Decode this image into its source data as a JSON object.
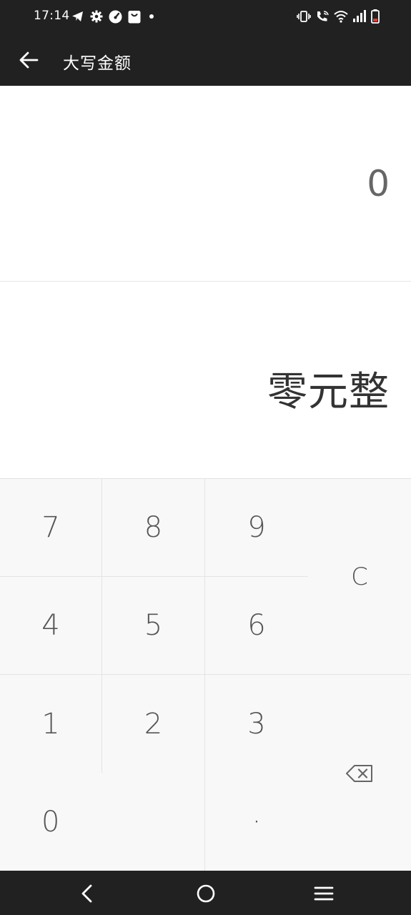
{
  "status_bar": {
    "time": "17:14",
    "left_icons": [
      "telegram-icon",
      "gear-icon",
      "speedometer-icon",
      "shopping-bag-icon",
      "dot-icon"
    ],
    "right_icons": [
      "vibrate-icon",
      "wifi-calling-icon",
      "wifi-icon",
      "signal-icon",
      "battery-icon"
    ],
    "battery_color": "#e53935"
  },
  "app_bar": {
    "title": "大写金额",
    "back_icon": "arrow-left-icon",
    "background": "#212121"
  },
  "display": {
    "number": "0",
    "chinese": "零元整"
  },
  "keypad": {
    "k7": "7",
    "k8": "8",
    "k9": "9",
    "k4": "4",
    "k5": "5",
    "k6": "6",
    "k1": "1",
    "k2": "2",
    "k3": "3",
    "k0": "0",
    "dot": "·",
    "clear": "C",
    "delete_icon": "backspace-icon"
  },
  "nav_bar": {
    "icons": [
      "back-nav-icon",
      "home-nav-icon",
      "menu-nav-icon"
    ]
  }
}
